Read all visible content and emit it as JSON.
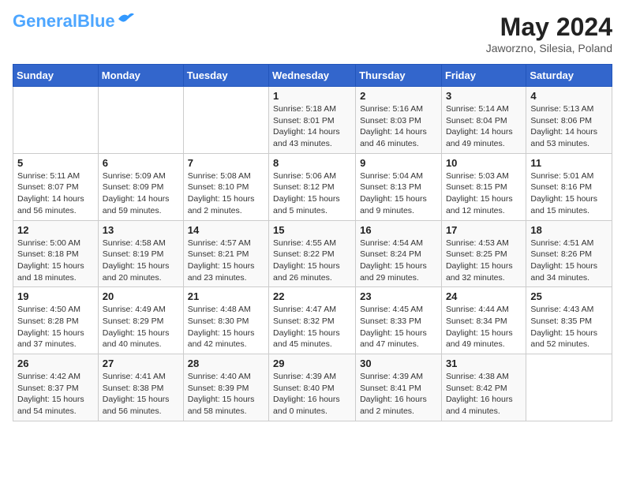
{
  "header": {
    "logo_line1": "General",
    "logo_line2": "Blue",
    "month_year": "May 2024",
    "location": "Jaworzno, Silesia, Poland"
  },
  "weekdays": [
    "Sunday",
    "Monday",
    "Tuesday",
    "Wednesday",
    "Thursday",
    "Friday",
    "Saturday"
  ],
  "weeks": [
    [
      {
        "day": "",
        "info": ""
      },
      {
        "day": "",
        "info": ""
      },
      {
        "day": "",
        "info": ""
      },
      {
        "day": "1",
        "info": "Sunrise: 5:18 AM\nSunset: 8:01 PM\nDaylight: 14 hours\nand 43 minutes."
      },
      {
        "day": "2",
        "info": "Sunrise: 5:16 AM\nSunset: 8:03 PM\nDaylight: 14 hours\nand 46 minutes."
      },
      {
        "day": "3",
        "info": "Sunrise: 5:14 AM\nSunset: 8:04 PM\nDaylight: 14 hours\nand 49 minutes."
      },
      {
        "day": "4",
        "info": "Sunrise: 5:13 AM\nSunset: 8:06 PM\nDaylight: 14 hours\nand 53 minutes."
      }
    ],
    [
      {
        "day": "5",
        "info": "Sunrise: 5:11 AM\nSunset: 8:07 PM\nDaylight: 14 hours\nand 56 minutes."
      },
      {
        "day": "6",
        "info": "Sunrise: 5:09 AM\nSunset: 8:09 PM\nDaylight: 14 hours\nand 59 minutes."
      },
      {
        "day": "7",
        "info": "Sunrise: 5:08 AM\nSunset: 8:10 PM\nDaylight: 15 hours\nand 2 minutes."
      },
      {
        "day": "8",
        "info": "Sunrise: 5:06 AM\nSunset: 8:12 PM\nDaylight: 15 hours\nand 5 minutes."
      },
      {
        "day": "9",
        "info": "Sunrise: 5:04 AM\nSunset: 8:13 PM\nDaylight: 15 hours\nand 9 minutes."
      },
      {
        "day": "10",
        "info": "Sunrise: 5:03 AM\nSunset: 8:15 PM\nDaylight: 15 hours\nand 12 minutes."
      },
      {
        "day": "11",
        "info": "Sunrise: 5:01 AM\nSunset: 8:16 PM\nDaylight: 15 hours\nand 15 minutes."
      }
    ],
    [
      {
        "day": "12",
        "info": "Sunrise: 5:00 AM\nSunset: 8:18 PM\nDaylight: 15 hours\nand 18 minutes."
      },
      {
        "day": "13",
        "info": "Sunrise: 4:58 AM\nSunset: 8:19 PM\nDaylight: 15 hours\nand 20 minutes."
      },
      {
        "day": "14",
        "info": "Sunrise: 4:57 AM\nSunset: 8:21 PM\nDaylight: 15 hours\nand 23 minutes."
      },
      {
        "day": "15",
        "info": "Sunrise: 4:55 AM\nSunset: 8:22 PM\nDaylight: 15 hours\nand 26 minutes."
      },
      {
        "day": "16",
        "info": "Sunrise: 4:54 AM\nSunset: 8:24 PM\nDaylight: 15 hours\nand 29 minutes."
      },
      {
        "day": "17",
        "info": "Sunrise: 4:53 AM\nSunset: 8:25 PM\nDaylight: 15 hours\nand 32 minutes."
      },
      {
        "day": "18",
        "info": "Sunrise: 4:51 AM\nSunset: 8:26 PM\nDaylight: 15 hours\nand 34 minutes."
      }
    ],
    [
      {
        "day": "19",
        "info": "Sunrise: 4:50 AM\nSunset: 8:28 PM\nDaylight: 15 hours\nand 37 minutes."
      },
      {
        "day": "20",
        "info": "Sunrise: 4:49 AM\nSunset: 8:29 PM\nDaylight: 15 hours\nand 40 minutes."
      },
      {
        "day": "21",
        "info": "Sunrise: 4:48 AM\nSunset: 8:30 PM\nDaylight: 15 hours\nand 42 minutes."
      },
      {
        "day": "22",
        "info": "Sunrise: 4:47 AM\nSunset: 8:32 PM\nDaylight: 15 hours\nand 45 minutes."
      },
      {
        "day": "23",
        "info": "Sunrise: 4:45 AM\nSunset: 8:33 PM\nDaylight: 15 hours\nand 47 minutes."
      },
      {
        "day": "24",
        "info": "Sunrise: 4:44 AM\nSunset: 8:34 PM\nDaylight: 15 hours\nand 49 minutes."
      },
      {
        "day": "25",
        "info": "Sunrise: 4:43 AM\nSunset: 8:35 PM\nDaylight: 15 hours\nand 52 minutes."
      }
    ],
    [
      {
        "day": "26",
        "info": "Sunrise: 4:42 AM\nSunset: 8:37 PM\nDaylight: 15 hours\nand 54 minutes."
      },
      {
        "day": "27",
        "info": "Sunrise: 4:41 AM\nSunset: 8:38 PM\nDaylight: 15 hours\nand 56 minutes."
      },
      {
        "day": "28",
        "info": "Sunrise: 4:40 AM\nSunset: 8:39 PM\nDaylight: 15 hours\nand 58 minutes."
      },
      {
        "day": "29",
        "info": "Sunrise: 4:39 AM\nSunset: 8:40 PM\nDaylight: 16 hours\nand 0 minutes."
      },
      {
        "day": "30",
        "info": "Sunrise: 4:39 AM\nSunset: 8:41 PM\nDaylight: 16 hours\nand 2 minutes."
      },
      {
        "day": "31",
        "info": "Sunrise: 4:38 AM\nSunset: 8:42 PM\nDaylight: 16 hours\nand 4 minutes."
      },
      {
        "day": "",
        "info": ""
      }
    ]
  ]
}
